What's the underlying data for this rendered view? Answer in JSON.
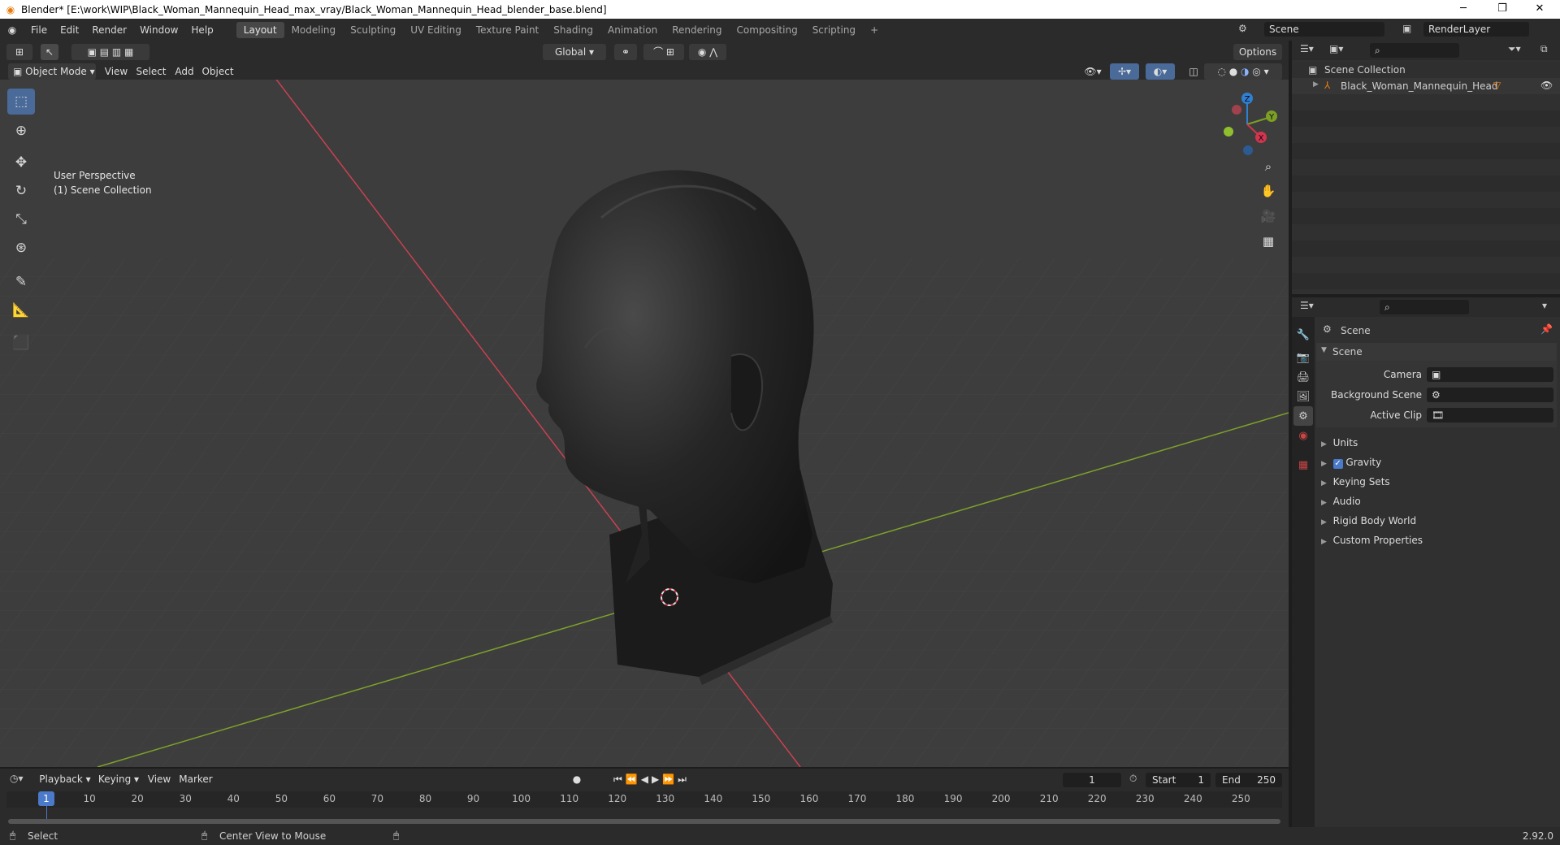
{
  "titlebar": {
    "title": "Blender* [E:\\work\\WIP\\Black_Woman_Mannequin_Head_max_vray/Black_Woman_Mannequin_Head_blender_base.blend]",
    "minimize": "─",
    "restore": "❐",
    "close": "✕"
  },
  "menu": {
    "items": [
      "File",
      "Edit",
      "Render",
      "Window",
      "Help"
    ]
  },
  "workspaces": [
    "Layout",
    "Modeling",
    "Sculpting",
    "UV Editing",
    "Texture Paint",
    "Shading",
    "Animation",
    "Rendering",
    "Compositing",
    "Scripting"
  ],
  "scene_field": "Scene",
  "renderlayer_field": "RenderLayer",
  "header": {
    "transform_orientation": "Global",
    "options": "Options",
    "mode": "Object Mode",
    "view": "View",
    "select": "Select",
    "add": "Add",
    "object": "Object"
  },
  "viewport": {
    "perspective": "User Perspective",
    "collection": "(1) Scene Collection",
    "axes": {
      "z": "Z",
      "y": "Y",
      "x": "X"
    }
  },
  "outliner": {
    "root": "Scene Collection",
    "items": [
      {
        "name": "Black_Woman_Mannequin_Head"
      }
    ]
  },
  "properties": {
    "context": "Scene",
    "panel": "Scene",
    "fields": [
      {
        "label": "Camera"
      },
      {
        "label": "Background Scene"
      },
      {
        "label": "Active Clip"
      }
    ],
    "sections": [
      "Units",
      "Gravity",
      "Keying Sets",
      "Audio",
      "Rigid Body World",
      "Custom Properties"
    ],
    "gravity_checked": true
  },
  "timeline": {
    "menus": [
      "Playback",
      "Keying",
      "View",
      "Marker"
    ],
    "current_frame": "1",
    "start_label": "Start",
    "start": "1",
    "end_label": "End",
    "end": "250",
    "ticks": [
      "1",
      "10",
      "20",
      "30",
      "40",
      "50",
      "60",
      "70",
      "80",
      "90",
      "100",
      "110",
      "120",
      "130",
      "140",
      "150",
      "160",
      "170",
      "180",
      "190",
      "200",
      "210",
      "220",
      "230",
      "240",
      "250"
    ]
  },
  "status": {
    "select": "Select",
    "center": "Center View to Mouse",
    "version": "2.92.0"
  },
  "colors": {
    "accent": "#4a6a99",
    "axis_x": "#d1364b",
    "axis_y": "#7ba024",
    "axis_z": "#2f80d1",
    "orange": "#e87d0d"
  }
}
